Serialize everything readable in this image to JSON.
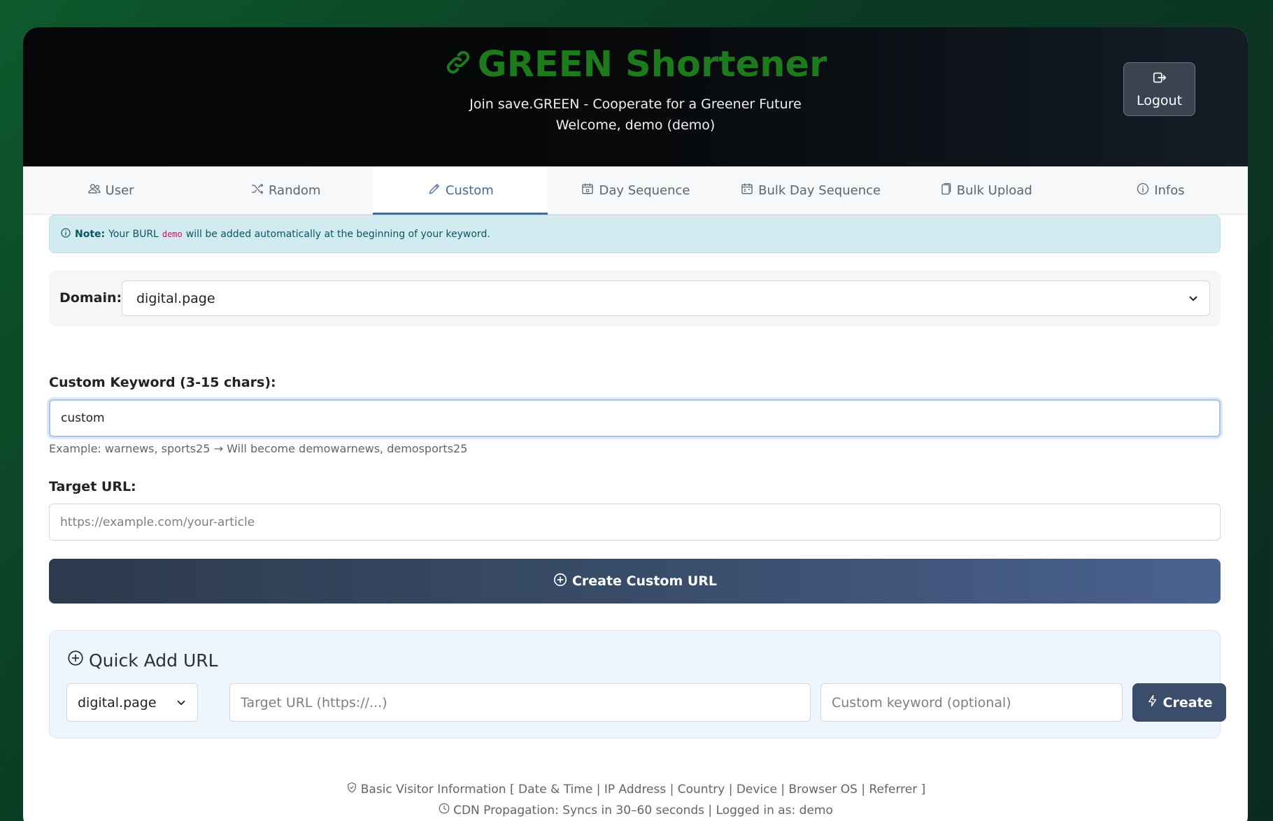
{
  "header": {
    "title": "GREEN Shortener",
    "subtitle": "Join save.GREEN - Cooperate for a Greener Future",
    "welcome": "Welcome, demo (demo)",
    "logout_label": "Logout"
  },
  "tabs": [
    {
      "label": "User",
      "icon": "users-icon"
    },
    {
      "label": "Random",
      "icon": "shuffle-icon"
    },
    {
      "label": "Custom",
      "icon": "pencil-icon",
      "active": true
    },
    {
      "label": "Day Sequence",
      "icon": "calendar-icon"
    },
    {
      "label": "Bulk Day Sequence",
      "icon": "calendar-range-icon"
    },
    {
      "label": "Bulk Upload",
      "icon": "files-icon"
    },
    {
      "label": "Infos",
      "icon": "info-icon"
    }
  ],
  "note": {
    "label": "Note:",
    "text_before": "Your BURL",
    "code": "demo",
    "text_after": "will be added automatically at the beginning of your keyword."
  },
  "form": {
    "domain_label": "Domain:",
    "domain_value": "digital.page",
    "keyword_label": "Custom Keyword (3-15 chars):",
    "keyword_value": "custom",
    "keyword_hint": "Example: warnews, sports25 → Will become demowarnews, demosports25",
    "target_label": "Target URL:",
    "target_placeholder": "https://example.com/your-article",
    "create_label": "Create Custom URL"
  },
  "quick_add": {
    "title": "Quick Add URL",
    "domain_value": "digital.page",
    "target_placeholder": "Target URL (https://...)",
    "keyword_placeholder": "Custom keyword (optional)",
    "create_label": "Create"
  },
  "footer": {
    "line1": "Basic Visitor Information [ Date & Time | IP Address | Country | Device | Browser OS | Referrer ]",
    "line2": "CDN Propagation: Syncs in 30–60 seconds | Logged in as: demo"
  },
  "colors": {
    "brand": "#1d7a1d",
    "accent": "#4a6a94"
  }
}
